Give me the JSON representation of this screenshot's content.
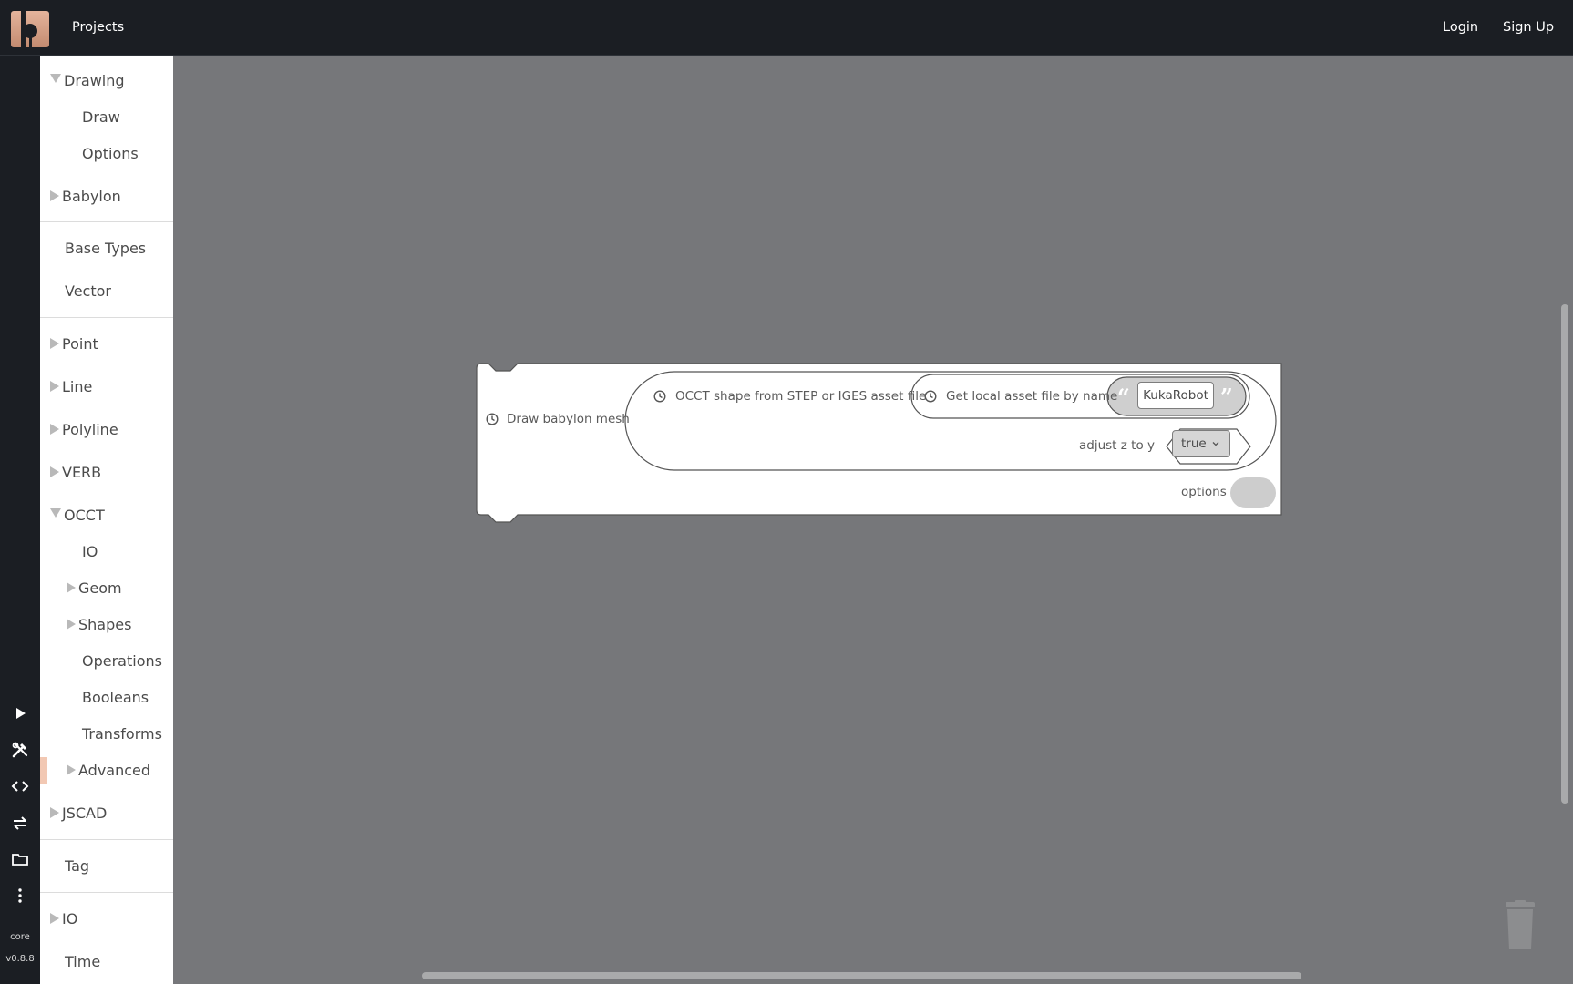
{
  "header": {
    "projects_label": "Projects",
    "login_label": "Login",
    "signup_label": "Sign Up",
    "logo_icon": "bitbybit-logo-icon"
  },
  "rail": {
    "icons": [
      "play-icon",
      "tools-icon",
      "code-icon",
      "swap-icon",
      "folder-icon",
      "more-vertical-icon"
    ],
    "core_label": "core",
    "version_label": "v0.8.8"
  },
  "toolbox": {
    "items": [
      {
        "label": "Drawing",
        "expand": "down"
      },
      {
        "label": "Draw"
      },
      {
        "label": "Options"
      },
      {
        "label": "Babylon",
        "expand": "right"
      },
      {
        "label": "Base Types"
      },
      {
        "label": "Vector"
      },
      {
        "label": "Point",
        "expand": "right"
      },
      {
        "label": "Line",
        "expand": "right"
      },
      {
        "label": "Polyline",
        "expand": "right"
      },
      {
        "label": "VERB",
        "expand": "right"
      },
      {
        "label": "OCCT",
        "expand": "down"
      },
      {
        "label": "IO"
      },
      {
        "label": "Geom",
        "expand": "right"
      },
      {
        "label": "Shapes",
        "expand": "right"
      },
      {
        "label": "Operations"
      },
      {
        "label": "Booleans"
      },
      {
        "label": "Transforms"
      },
      {
        "label": "Advanced",
        "expand": "right"
      },
      {
        "label": "JSCAD",
        "expand": "right"
      },
      {
        "label": "Tag"
      },
      {
        "label": "IO",
        "expand": "right"
      },
      {
        "label": "Time"
      }
    ]
  },
  "block": {
    "main_label": "Draw babylon mesh",
    "occt_label": "OCCT shape from STEP or IGES asset file",
    "asset_label": "Get local asset file by name",
    "asset_value": "KukaRobot",
    "quote_open": "“",
    "quote_close": "”",
    "adjust_label": "adjust z to y",
    "adjust_value": "true",
    "options_label": "options"
  },
  "colors": {
    "topbar": "#1b1e23",
    "workspace": "#76777a",
    "accent": "#f2c8b3"
  }
}
